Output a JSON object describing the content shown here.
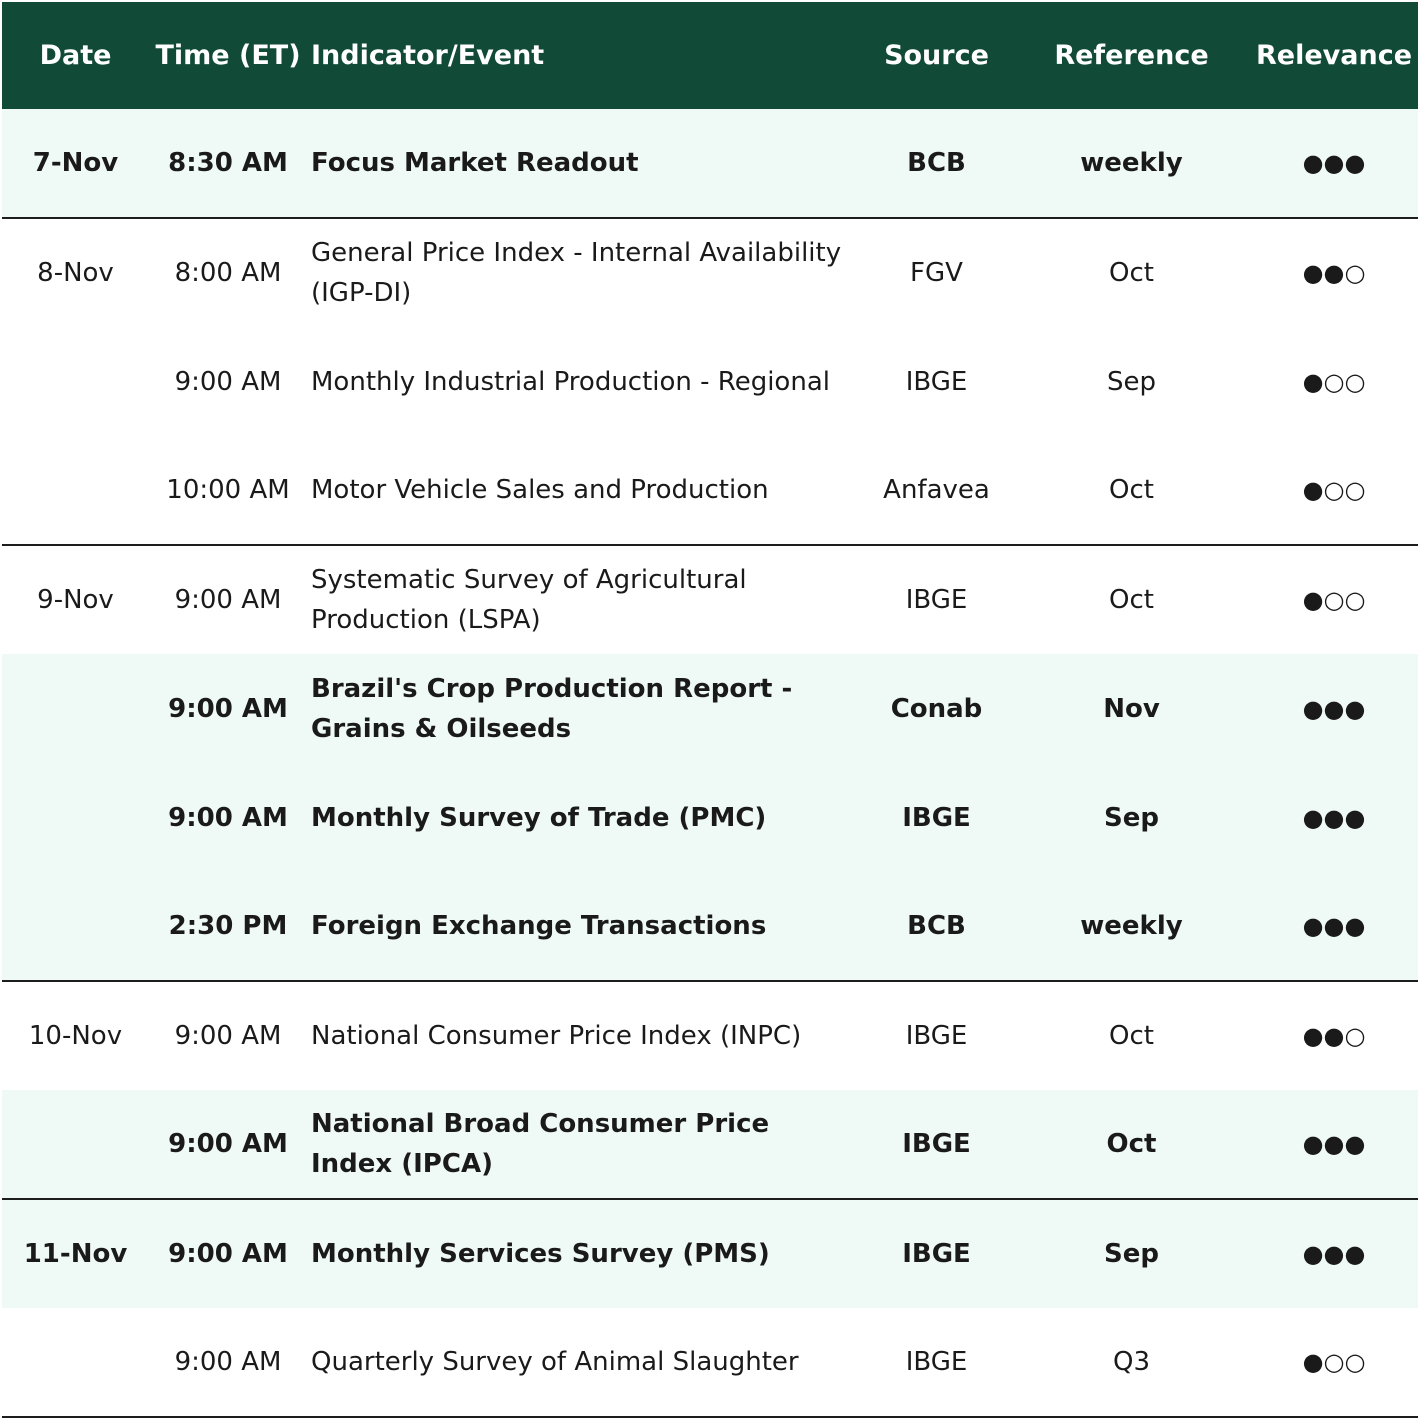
{
  "headers": {
    "date": "Date",
    "time": "Time (ET)",
    "event": "Indicator/Event",
    "source": "Source",
    "reference": "Reference",
    "relevance": "Relevance"
  },
  "rows": [
    {
      "date": "7-Nov",
      "time": "8:30 AM",
      "event": "Focus Market Readout",
      "source": "BCB",
      "reference": "weekly",
      "relevance": "●●●"
    },
    {
      "date": "8-Nov",
      "time": "8:00 AM",
      "event": "General Price Index - Internal Availability (IGP-DI)",
      "source": "FGV",
      "reference": "Oct",
      "relevance": "●●○"
    },
    {
      "date": "",
      "time": "9:00 AM",
      "event": "Monthly Industrial Production - Regional",
      "source": "IBGE",
      "reference": "Sep",
      "relevance": "●○○"
    },
    {
      "date": "",
      "time": "10:00 AM",
      "event": "Motor Vehicle Sales and Production",
      "source": "Anfavea",
      "reference": "Oct",
      "relevance": "●○○"
    },
    {
      "date": "9-Nov",
      "time": "9:00 AM",
      "event": "Systematic Survey of Agricultural Production (LSPA)",
      "source": "IBGE",
      "reference": "Oct",
      "relevance": "●○○"
    },
    {
      "date": "",
      "time": "9:00 AM",
      "event": "Brazil's Crop Production Report - Grains & Oilseeds",
      "source": "Conab",
      "reference": "Nov",
      "relevance": "●●●"
    },
    {
      "date": "",
      "time": "9:00 AM",
      "event": "Monthly Survey of Trade (PMC)",
      "source": "IBGE",
      "reference": "Sep",
      "relevance": "●●●"
    },
    {
      "date": "",
      "time": "2:30 PM",
      "event": "Foreign Exchange Transactions",
      "source": "BCB",
      "reference": "weekly",
      "relevance": "●●●"
    },
    {
      "date": "10-Nov",
      "time": "9:00 AM",
      "event": "National Consumer Price Index (INPC)",
      "source": "IBGE",
      "reference": "Oct",
      "relevance": "●●○"
    },
    {
      "date": "",
      "time": "9:00 AM",
      "event": "National Broad Consumer Price Index (IPCA)",
      "source": "IBGE",
      "reference": "Oct",
      "relevance": "●●●"
    },
    {
      "date": "11-Nov",
      "time": "9:00 AM",
      "event": "Monthly Services Survey (PMS)",
      "source": "IBGE",
      "reference": "Sep",
      "relevance": "●●●"
    },
    {
      "date": "",
      "time": "9:00 AM",
      "event": "Quarterly Survey of Animal Slaughter",
      "source": "IBGE",
      "reference": "Q3",
      "relevance": "●○○"
    }
  ],
  "colors": {
    "header_bg": "#114a36",
    "header_text": "#ffffff",
    "highlight_bg": "#eff9f6",
    "separator": "#1d1d1d"
  }
}
